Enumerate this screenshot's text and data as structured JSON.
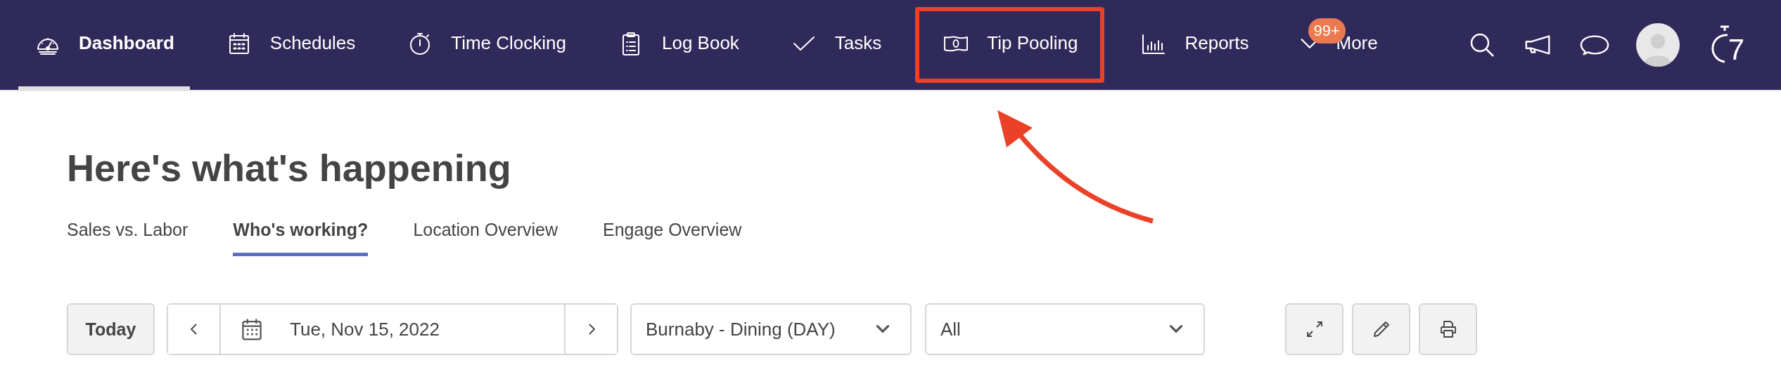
{
  "nav": {
    "items": [
      {
        "label": "Dashboard",
        "selected": true,
        "highlighted": false
      },
      {
        "label": "Schedules",
        "selected": false,
        "highlighted": false
      },
      {
        "label": "Time Clocking",
        "selected": false,
        "highlighted": false
      },
      {
        "label": "Log Book",
        "selected": false,
        "highlighted": false
      },
      {
        "label": "Tasks",
        "selected": false,
        "highlighted": false
      },
      {
        "label": "Tip Pooling",
        "selected": false,
        "highlighted": true
      },
      {
        "label": "Reports",
        "selected": false,
        "highlighted": false
      },
      {
        "label": "More",
        "selected": false,
        "highlighted": false,
        "badge": "99+"
      }
    ],
    "logo_text": "7"
  },
  "page": {
    "title": "Here's what's happening",
    "tabs": [
      {
        "label": "Sales vs. Labor",
        "selected": false
      },
      {
        "label": "Who's working?",
        "selected": true
      },
      {
        "label": "Location Overview",
        "selected": false
      },
      {
        "label": "Engage Overview",
        "selected": false
      }
    ],
    "toolbar": {
      "today": "Today",
      "date": "Tue, Nov 15, 2022",
      "location": "Burnaby - Dining (DAY)",
      "filter": "All"
    }
  }
}
